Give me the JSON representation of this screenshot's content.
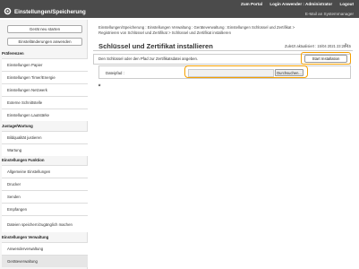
{
  "header": {
    "title": "Einstellungen/Speicherung",
    "links": [
      "Zum Portal",
      "Login Anwender : Administrator",
      "Logout"
    ],
    "mail_link": "E-Mail an Systemmanager"
  },
  "sidebar": {
    "restart_button": "Gerät neu starten",
    "apply_button": "Einstelländerungen anwenden",
    "sections": [
      {
        "title": "Präferenzen",
        "items": [
          "Einstellungen Papier",
          "Einstellungen Timer/Energie",
          "Einstellungen Netzwerk",
          "Externe Schnittstelle",
          "Einstellungen Lautstärke"
        ]
      },
      {
        "title": "Justage/Wartung",
        "items": [
          "Bildqualität justieren",
          "Wartung"
        ]
      },
      {
        "title": "Einstellungen Funktion",
        "items": [
          "Allgemeine Einstellungen",
          "Drucker",
          "Senden",
          "Empfangen",
          "Dateien speichern/zugänglich machen"
        ]
      },
      {
        "title": "Einstellungen Verwaltung",
        "items": [
          "Anwenderverwaltung",
          "Geräteverwaltung"
        ]
      }
    ]
  },
  "main": {
    "breadcrumb_line1": "Einstellungen/Speicherung : Einstellungen Verwaltung : Geräteverwaltung : Einstellungen Schlüssel und Zertifikat >",
    "breadcrumb_line2": "Registrieren von Schlüssel und Zertifikat > Schlüssel und Zertifikat installieren",
    "title": "Schlüssel und Zertifikat installieren",
    "updated": "Zuletzt aktualisiert : 15/04 2021 23:28:15",
    "hint": "Den Schlüssel oder den Pfad zur Zertifikatsdatei angeben.",
    "start_button": "Start Installation",
    "file_label": "Dateipfad :",
    "browse_button": "Durchsuchen..."
  }
}
